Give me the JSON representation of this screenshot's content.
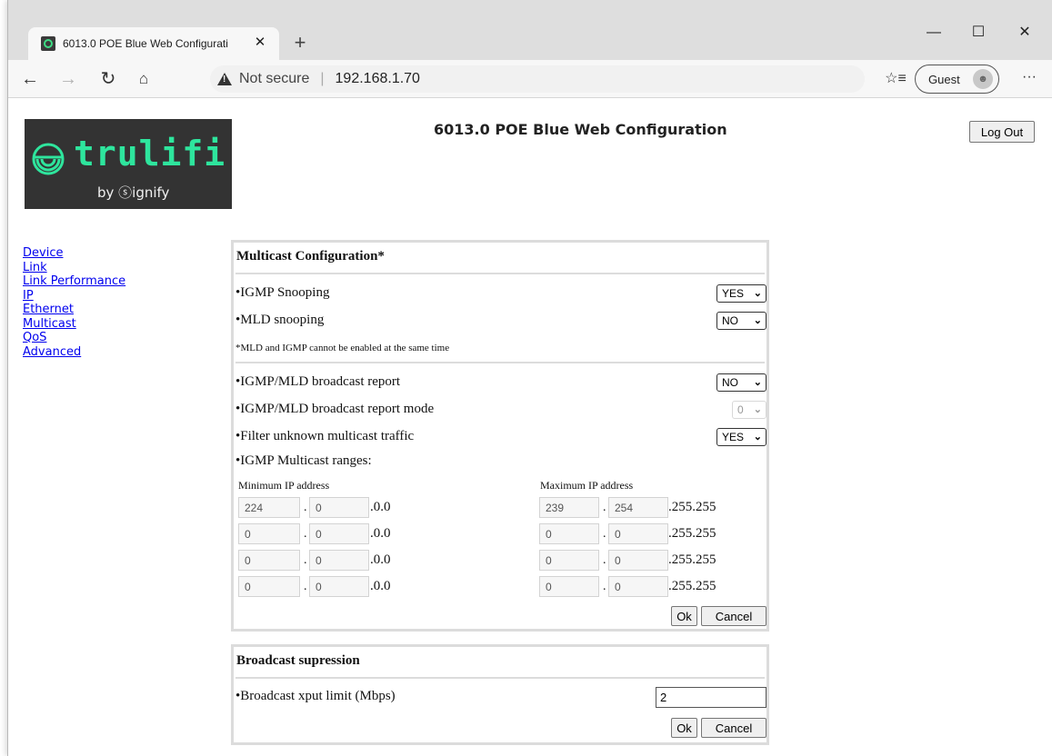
{
  "browser": {
    "tab_title": "6013.0 POE Blue Web Configurati",
    "tab_close": "✕",
    "new_tab": "+",
    "not_secure": "Not secure",
    "url": "192.168.1.70",
    "profile": "Guest",
    "more": "···"
  },
  "logo": {
    "name": "trulifi",
    "tagline": "by ⓢignify"
  },
  "header": {
    "title": "6013.0 POE Blue Web Configuration",
    "logout": "Log Out"
  },
  "nav": [
    "Device",
    "Link",
    "Link Performance",
    "IP",
    "Ethernet",
    "Multicast",
    "QoS",
    "Advanced"
  ],
  "multicast": {
    "heading": "Multicast Configuration*",
    "igmp_label": "•IGMP Snooping",
    "igmp_value": "YES",
    "mld_label": "•MLD snooping",
    "mld_value": "NO",
    "note": "*MLD and IGMP cannot be enabled at the same time",
    "report_label": "•IGMP/MLD broadcast report",
    "report_value": "NO",
    "mode_label": "•IGMP/MLD broadcast report mode",
    "mode_value": "0",
    "filter_label": "•Filter unknown multicast traffic",
    "filter_value": "YES",
    "ranges_label": "•IGMP Multicast ranges:",
    "min_header": "Minimum IP address",
    "max_header": "Maximum IP address",
    "min_suffix": ".0.0",
    "max_suffix": ".255.255",
    "ranges": [
      {
        "min": [
          "224",
          "0"
        ],
        "max": [
          "239",
          "254"
        ]
      },
      {
        "min": [
          "0",
          "0"
        ],
        "max": [
          "0",
          "0"
        ]
      },
      {
        "min": [
          "0",
          "0"
        ],
        "max": [
          "0",
          "0"
        ]
      },
      {
        "min": [
          "0",
          "0"
        ],
        "max": [
          "0",
          "0"
        ]
      }
    ],
    "ok": "Ok",
    "cancel": "Cancel"
  },
  "broadcast": {
    "heading": "Broadcast supression",
    "limit_label": "•Broadcast xput limit (Mbps)",
    "limit_value": "2",
    "ok": "Ok",
    "cancel": "Cancel"
  }
}
